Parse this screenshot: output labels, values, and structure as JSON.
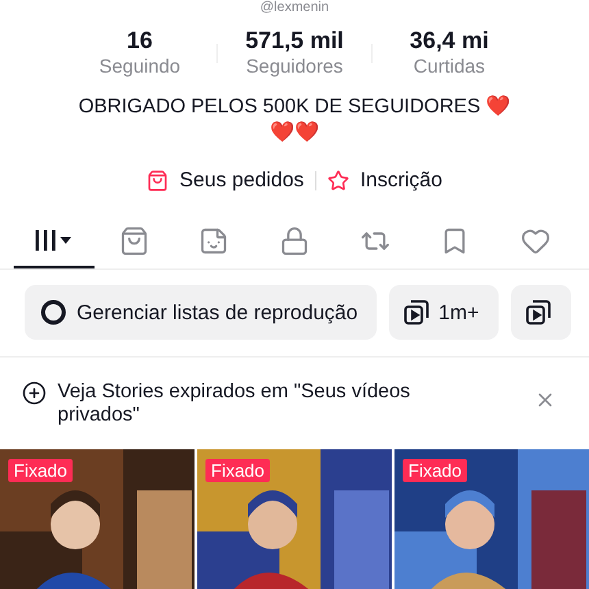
{
  "profile": {
    "handle": "@lexmenin"
  },
  "stats": [
    {
      "value": "16",
      "label": "Seguindo"
    },
    {
      "value": "571,5 mil",
      "label": "Seguidores"
    },
    {
      "value": "36,4 mi",
      "label": "Curtidas"
    }
  ],
  "bio": "OBRIGADO PELOS 500K DE SEGUIDORES ❤️ ❤️❤️",
  "links": [
    {
      "kind": "orders",
      "label": "Seus pedidos"
    },
    {
      "kind": "subscription",
      "label": "Inscrição"
    }
  ],
  "tabs": [
    {
      "kind": "grid",
      "selected": true
    },
    {
      "kind": "shop",
      "selected": false
    },
    {
      "kind": "sticker",
      "selected": false
    },
    {
      "kind": "private",
      "selected": false
    },
    {
      "kind": "repost",
      "selected": false
    },
    {
      "kind": "saved",
      "selected": false
    },
    {
      "kind": "liked",
      "selected": false
    }
  ],
  "chips": [
    {
      "kind": "manage",
      "label": "Gerenciar listas de reprodução"
    },
    {
      "kind": "playlist",
      "label": "1m+"
    },
    {
      "kind": "playlist"
    }
  ],
  "notice": {
    "text": "Veja Stories expirados em \"Seus vídeos privados\""
  },
  "videos": [
    {
      "kind": "picture",
      "badge": "Fixado"
    },
    {
      "kind": "picture",
      "badge": "Fixado"
    },
    {
      "kind": "picture",
      "badge": "Fixado"
    }
  ]
}
